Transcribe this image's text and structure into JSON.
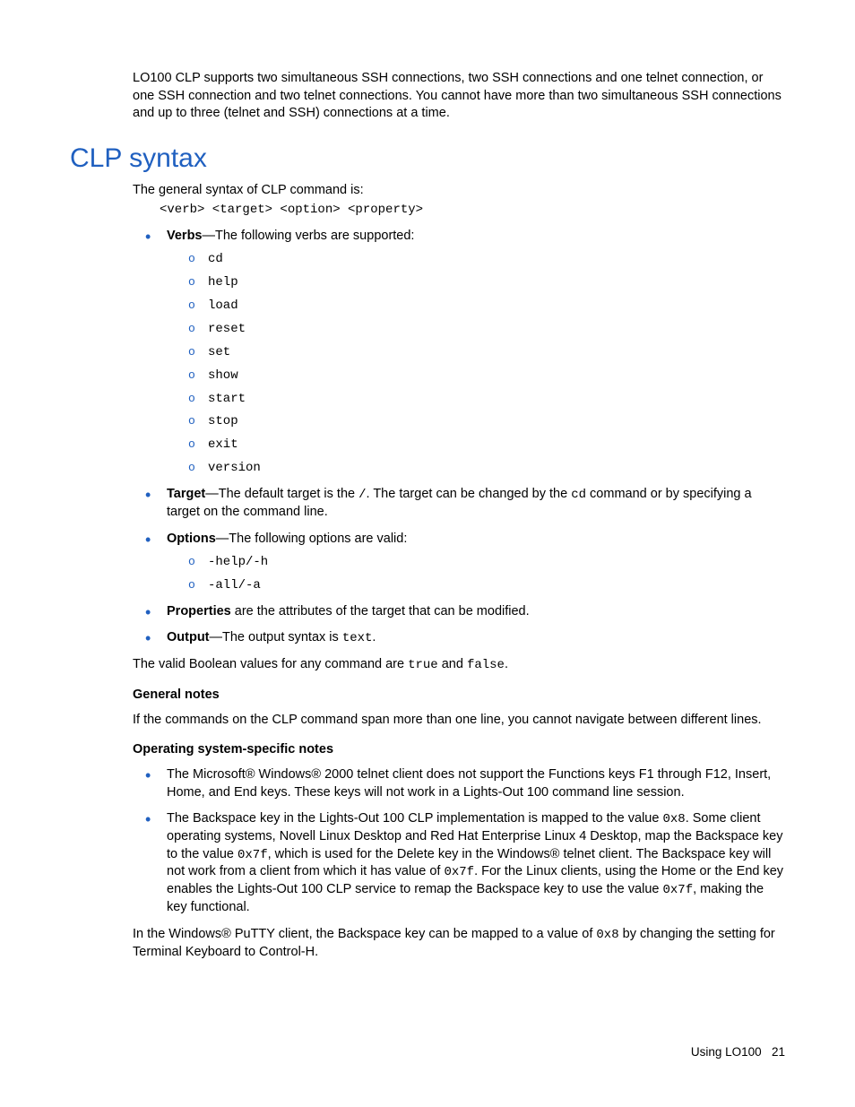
{
  "intro": "LO100 CLP supports two simultaneous SSH connections, two SSH connections and one telnet connection, or one SSH connection and two telnet connections. You cannot have more than two simultaneous SSH connections and up to three (telnet and SSH) connections at a time.",
  "heading": "CLP syntax",
  "general_syntax_label": "The general syntax of CLP command is:",
  "syntax_code": "<verb> <target> <option> <property>",
  "verbs_label_bold": "Verbs",
  "verbs_label_rest": "—The following verbs are supported:",
  "verbs": [
    "cd",
    "help",
    "load",
    "reset",
    "set",
    "show",
    "start",
    "stop",
    "exit",
    "version"
  ],
  "target_label_bold": "Target",
  "target_text_a": "—The default target is the ",
  "target_code_a": "/",
  "target_text_b": ". The target can be changed by the ",
  "target_code_b": "cd",
  "target_text_c": " command or by specifying a target on the command line.",
  "options_label_bold": "Options",
  "options_label_rest": "—The following options are valid:",
  "options": [
    "-help/-h",
    "-all/-a"
  ],
  "properties_label_bold": "Properties",
  "properties_text": " are the attributes of the target that can be modified.",
  "output_label_bold": "Output",
  "output_text_a": "—The output syntax is ",
  "output_code": "text",
  "output_text_b": ".",
  "bool_text_a": "The valid Boolean values for any command are ",
  "bool_code_a": "true",
  "bool_text_b": " and ",
  "bool_code_b": "false",
  "bool_text_c": ".",
  "general_notes_heading": "General notes",
  "general_notes_text": "If the commands on the CLP command span more than one line, you cannot navigate between different lines.",
  "os_notes_heading": "Operating system-specific notes",
  "os_note_1": "The Microsoft® Windows® 2000 telnet client does not support the Functions keys F1 through F12, Insert, Home, and End keys. These keys will not work in a Lights-Out 100 command line session.",
  "os_note_2a": "The Backspace key in the Lights-Out 100 CLP implementation is mapped to the value ",
  "os_note_2_code1": "0x8",
  "os_note_2b": ". Some client operating systems, Novell Linux Desktop and Red Hat Enterprise Linux 4 Desktop, map the Backspace key to the value ",
  "os_note_2_code2": "0x7f",
  "os_note_2c": ", which is used for the Delete key in the Windows® telnet client. The Backspace key will not work from a client from which it has value of ",
  "os_note_2_code3": "0x7f",
  "os_note_2d": ". For the Linux clients, using the Home or the End key enables the Lights-Out 100 CLP service to remap the Backspace key to use the value ",
  "os_note_2_code4": "0x7f",
  "os_note_2e": ", making the key functional.",
  "putty_text_a": "In the Windows® PuTTY client, the Backspace key can be mapped to a value of ",
  "putty_code": "0x8",
  "putty_text_b": " by changing the setting for Terminal Keyboard to Control-H.",
  "footer_label": "Using LO100",
  "footer_page": "21"
}
